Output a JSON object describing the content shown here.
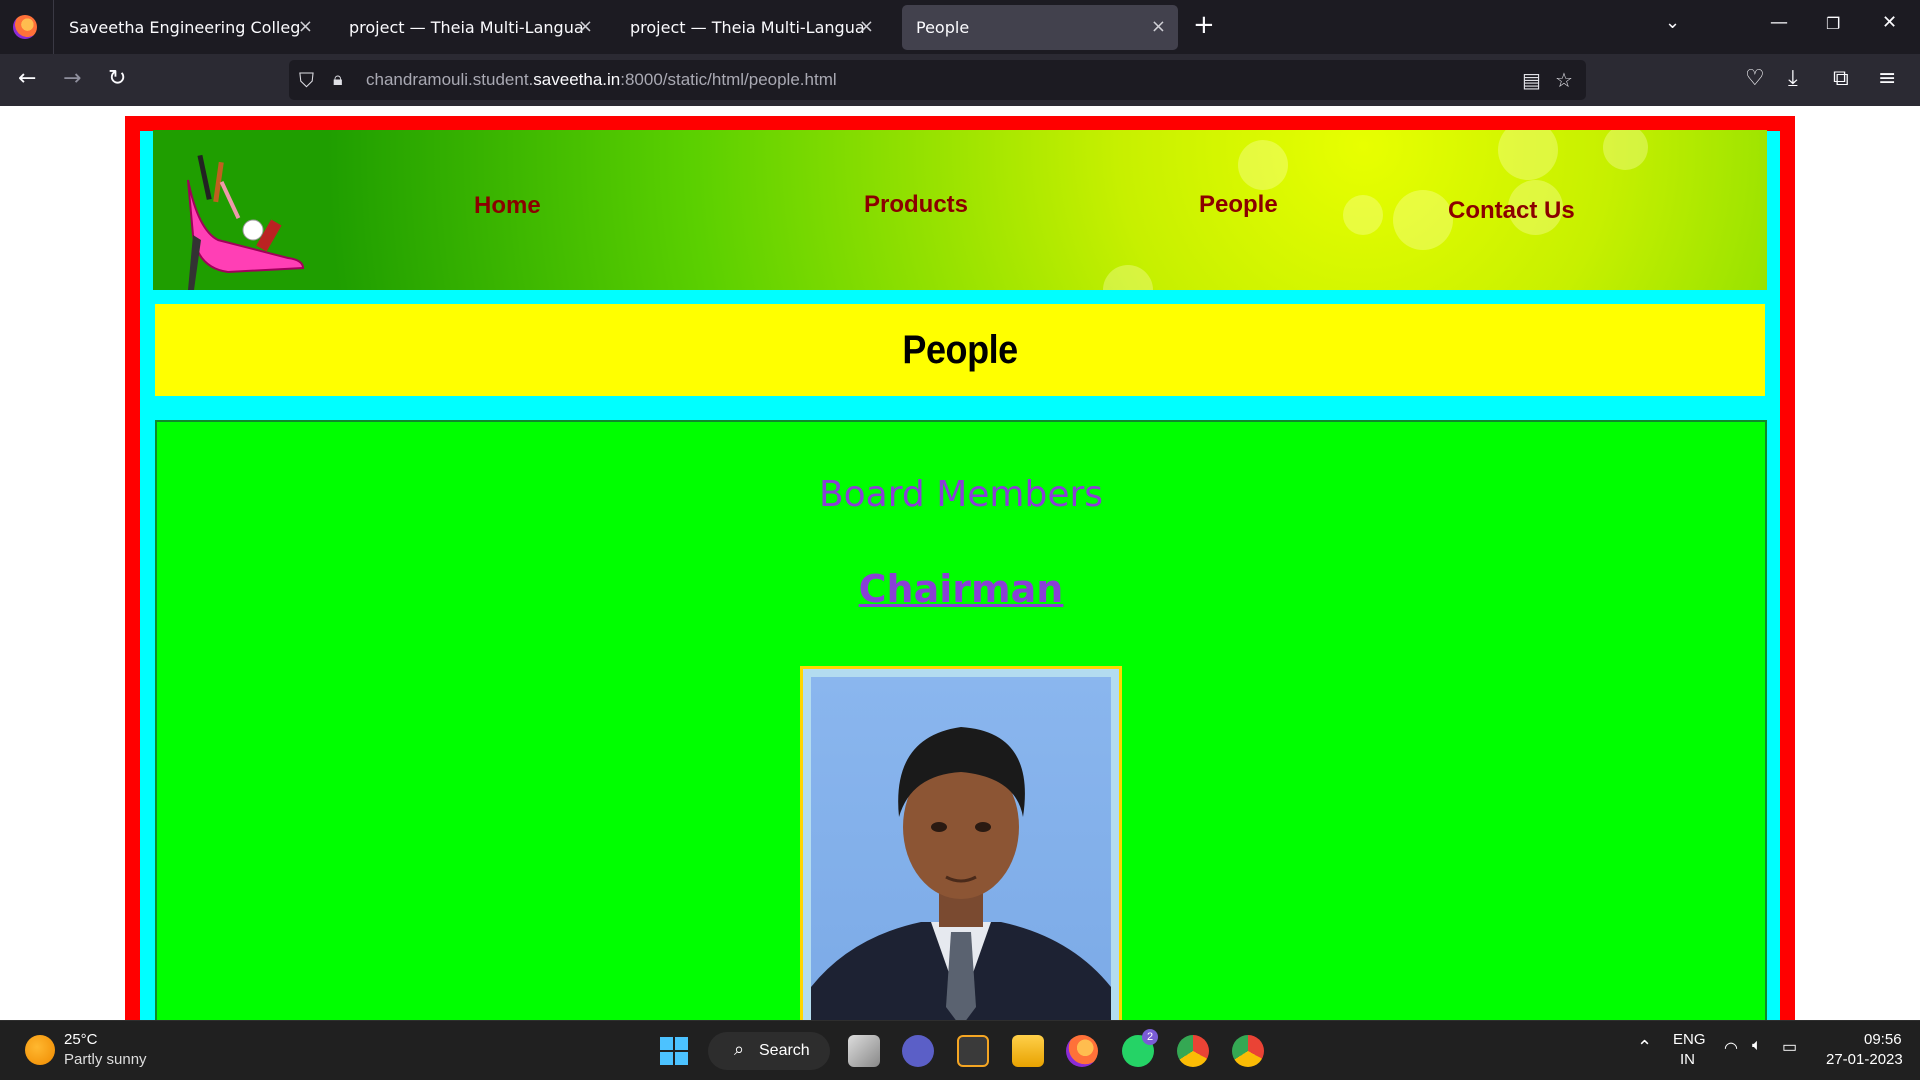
{
  "browser": {
    "tabs": [
      {
        "label": "Saveetha Engineering College",
        "active": false
      },
      {
        "label": "project — Theia Multi-Language Ex",
        "active": false
      },
      {
        "label": "project — Theia Multi-Language Ex",
        "active": false
      },
      {
        "label": "People",
        "active": true
      }
    ],
    "url_prefix": "chandramouli.student.",
    "url_host": "saveetha.in",
    "url_suffix": ":8000/static/html/people.html"
  },
  "site": {
    "nav": {
      "home": "Home",
      "products": "Products",
      "people": "People",
      "contact": "Contact Us"
    },
    "banner_title": "People",
    "section_title": "Board Members",
    "role_title": "Chairman"
  },
  "taskbar": {
    "weather_temp": "25°C",
    "weather_desc": "Partly sunny",
    "search_label": "Search",
    "lang": "ENG",
    "region": "IN",
    "time": "09:56",
    "date": "27-01-2023",
    "whatsapp_badge": "2"
  },
  "colors": {
    "frame_red": "#ff0000",
    "frame_cyan": "#00ffff",
    "banner_yellow": "#ffff00",
    "content_green": "#00ff00",
    "nav_text": "#8b0000",
    "heading_purple": "#8a3fd6"
  }
}
